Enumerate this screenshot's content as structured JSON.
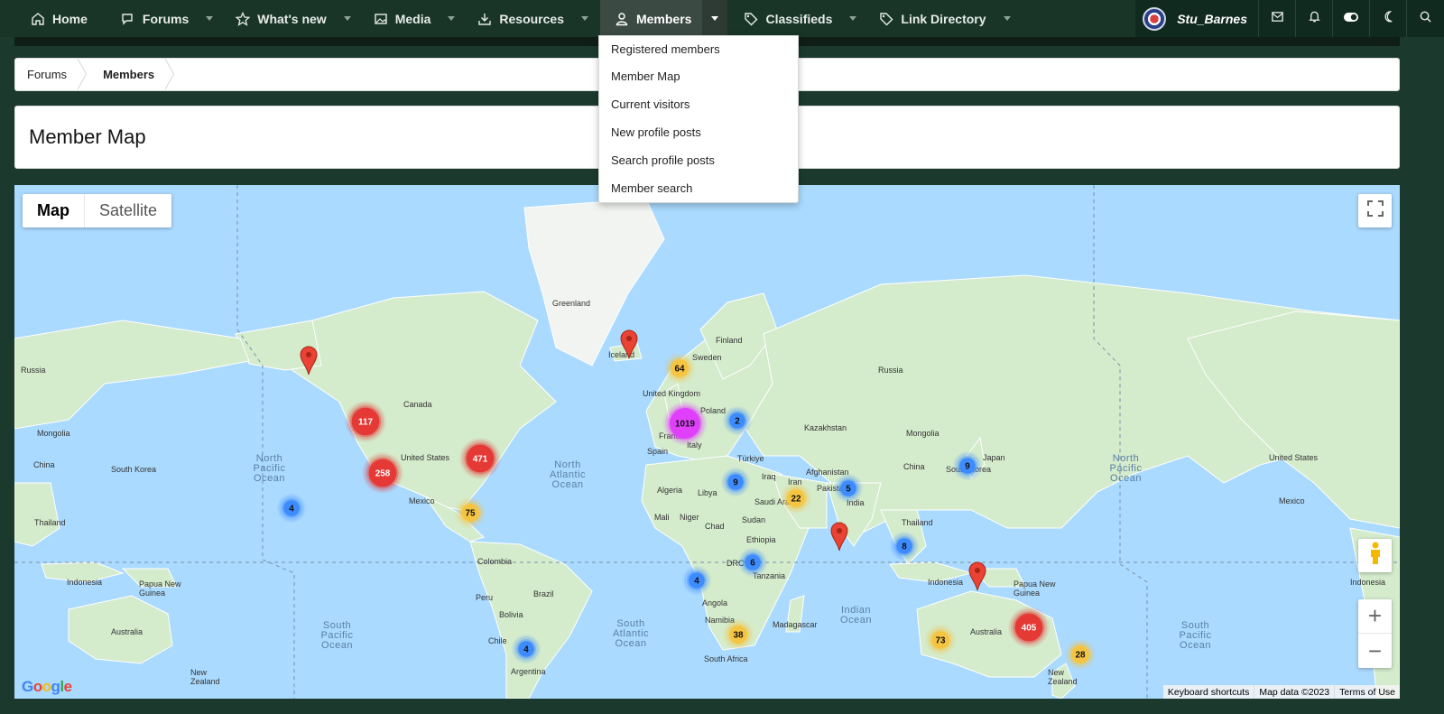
{
  "nav": {
    "items": [
      {
        "label": "Home",
        "icon": "home-icon"
      },
      {
        "label": "Forums",
        "icon": "chat-icon"
      },
      {
        "label": "What's new",
        "icon": "star-icon"
      },
      {
        "label": "Media",
        "icon": "image-icon"
      },
      {
        "label": "Resources",
        "icon": "download-icon"
      },
      {
        "label": "Members",
        "icon": "user-icon"
      },
      {
        "label": "Classifieds",
        "icon": "tag-icon"
      },
      {
        "label": "Link Directory",
        "icon": "tag-icon"
      }
    ],
    "active": "Members"
  },
  "user": {
    "name": "Stu_Barnes",
    "buttons": [
      "inbox-icon",
      "bell-icon",
      "toggle-icon",
      "moon-icon",
      "search-icon"
    ]
  },
  "members_menu": {
    "items": [
      "Registered members",
      "Member Map",
      "Current visitors",
      "New profile posts",
      "Search profile posts",
      "Member search"
    ]
  },
  "breadcrumb": {
    "items": [
      "Forums",
      "Members"
    ]
  },
  "page": {
    "title": "Member Map"
  },
  "map": {
    "type_buttons": [
      "Map",
      "Satellite"
    ],
    "selected_type": "Map",
    "zoom_in": "+",
    "zoom_out": "−",
    "logo": "Google",
    "attribution": [
      "Keyboard shortcuts",
      "Map data ©2023",
      "Terms of Use"
    ],
    "clusters": [
      {
        "count": "64",
        "color": "#f5c542"
      },
      {
        "count": "1019",
        "color": "#e040fb"
      },
      {
        "count": "2",
        "color": "#3d8bfd"
      },
      {
        "count": "117",
        "color": "#e53935"
      },
      {
        "count": "471",
        "color": "#e53935"
      },
      {
        "count": "258",
        "color": "#e53935"
      },
      {
        "count": "4",
        "color": "#3d8bfd"
      },
      {
        "count": "75",
        "color": "#f5c542"
      },
      {
        "count": "9",
        "color": "#3d8bfd"
      },
      {
        "count": "22",
        "color": "#f5c542"
      },
      {
        "count": "5",
        "color": "#3d8bfd"
      },
      {
        "count": "9",
        "color": "#3d8bfd"
      },
      {
        "count": "8",
        "color": "#3d8bfd"
      },
      {
        "count": "6",
        "color": "#3d8bfd"
      },
      {
        "count": "4",
        "color": "#3d8bfd"
      },
      {
        "count": "38",
        "color": "#f5c542"
      },
      {
        "count": "4",
        "color": "#3d8bfd"
      },
      {
        "count": "405",
        "color": "#e53935"
      },
      {
        "count": "73",
        "color": "#f5c542"
      },
      {
        "count": "28",
        "color": "#f5c542"
      }
    ],
    "place_labels": [
      "Greenland",
      "Iceland",
      "Finland",
      "Sweden",
      "Russia",
      "Russia",
      "Canada",
      "United States",
      "Mexico",
      "United Kingdom",
      "Poland",
      "France",
      "Spain",
      "Italy",
      "Türkiye",
      "Kazakhstan",
      "Mongolia",
      "Mongolia",
      "Iraq",
      "Iran",
      "Afghanistan",
      "Pakistan",
      "India",
      "China",
      "China",
      "Japan",
      "South Korea",
      "South Korea",
      "United States",
      "Mexico",
      "Algeria",
      "Libya",
      "Mali",
      "Niger",
      "Chad",
      "Sudan",
      "Saudi Arabia",
      "Ethiopia",
      "DRC",
      "Tanzania",
      "Angola",
      "Namibia",
      "Madagascar",
      "South Africa",
      "Colombia",
      "Peru",
      "Brazil",
      "Bolivia",
      "Chile",
      "Argentina",
      "Thailand",
      "Thailand",
      "Indonesia",
      "Indonesia",
      "Indonesia",
      "Papua New Guinea",
      "Papua New Guinea",
      "Australia",
      "Australia",
      "New Zealand",
      "New Zealand"
    ],
    "oceans": [
      "North Pacific Ocean",
      "North Atlantic Ocean",
      "North Pacific Ocean",
      "South Pacific Ocean",
      "South Atlantic Ocean",
      "Indian Ocean",
      "South Pacific Ocean"
    ]
  },
  "colors": {
    "nav_bg": "#183528",
    "page_bg": "#1b3a2d",
    "water": "#aadaff",
    "land": "#cfe8c0"
  }
}
